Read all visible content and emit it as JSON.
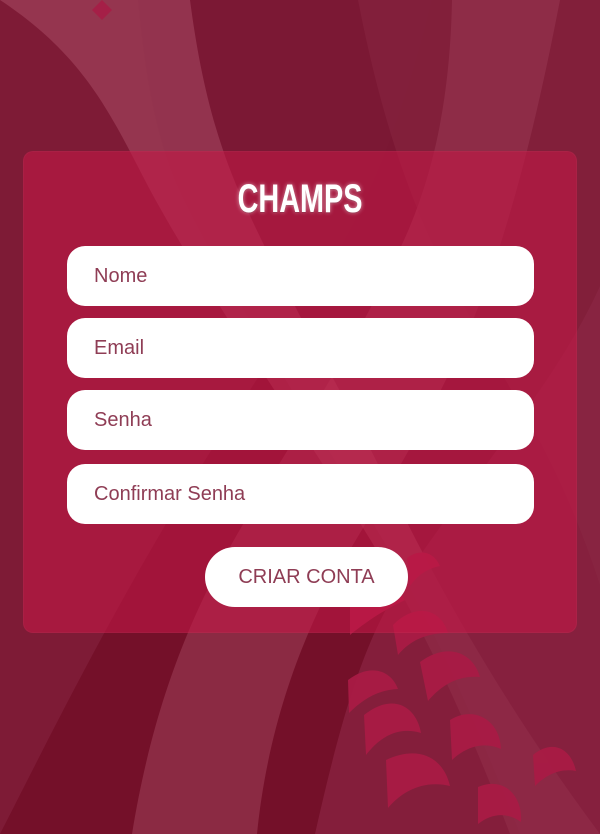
{
  "form": {
    "title": "CHAMPS",
    "fields": {
      "name_placeholder": "Nome",
      "email_placeholder": "Email",
      "password_placeholder": "Senha",
      "confirm_password_placeholder": "Confirmar Senha"
    },
    "submit_label": "CRIAR CONTA"
  },
  "colors": {
    "background": "#741029",
    "card": "#C41846",
    "input_background": "#FFFFFF",
    "text": "#8F3D55",
    "title": "#FFFFFF"
  }
}
